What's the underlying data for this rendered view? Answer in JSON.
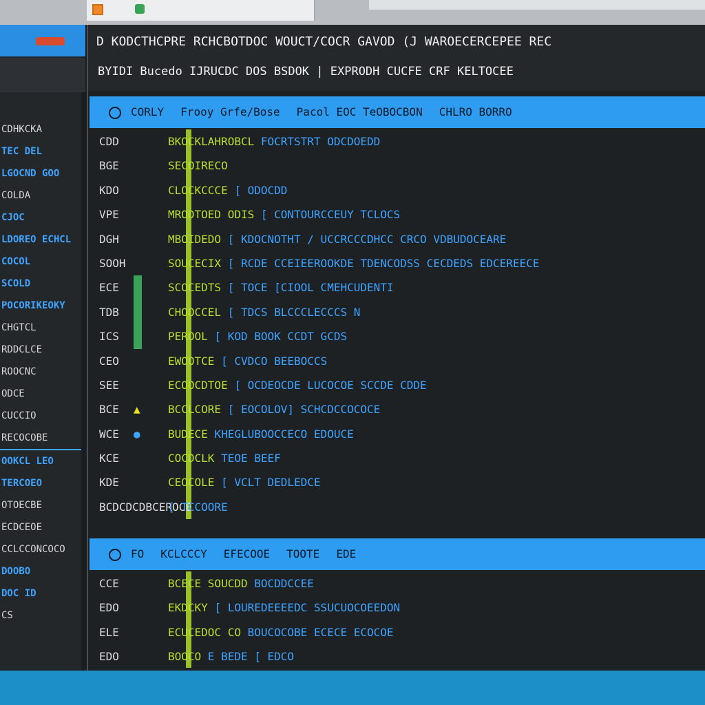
{
  "colors": {
    "accent": "#2e9cf0",
    "keyword": "#b9e02c",
    "link": "#3ea4ff",
    "background": "#1e2124"
  },
  "header": {
    "row1": "D KODCTHCPRE RCHCBOTDOC WOUCT/COCR GAVOD (J WAROECERCEPEE REC",
    "row2": "BYIDI Bucedo IJRUCDC DOS BSDOK | EXPRODH CUCFE CRF KELTOCEE"
  },
  "sidebar": {
    "items": [
      {
        "label": "CDHKCKA"
      },
      {
        "label": "TEC DEL"
      },
      {
        "label": "LGOCND GOO"
      },
      {
        "label": "COLDA"
      },
      {
        "label": "CJOC"
      },
      {
        "label": "LDOREO ECHCL"
      },
      {
        "label": "COCOL"
      },
      {
        "label": "SCOLD"
      },
      {
        "label": "POCORIKEOKY"
      },
      {
        "label": "CHGTCL"
      },
      {
        "label": "RDDCLCE"
      },
      {
        "label": "ROOCNC"
      },
      {
        "label": "ODCE"
      },
      {
        "label": "CUCCIO"
      },
      {
        "label": "RECOCOBE"
      },
      {
        "label": "OOKCL LEO"
      },
      {
        "label": "TERCOEO"
      },
      {
        "label": "OTOECBE"
      },
      {
        "label": "ECDCEOE"
      },
      {
        "label": "CCLCCONCOCO"
      },
      {
        "label": "DOOBO"
      },
      {
        "label": "DOC ID"
      },
      {
        "label": "CS"
      }
    ]
  },
  "pane1": {
    "tabs": [
      "CORLY",
      "Frooy Grfe/Bose",
      "Pacol EOC TeOBOCBON",
      "CHLRO BORRO"
    ],
    "lines": [
      {
        "n": "CDD",
        "kw": "BKOCKLAHROBCL",
        "rest": " FOCRTSTRT ODCDOEDD"
      },
      {
        "n": "BGE",
        "kw": "SECOIRECO",
        "rest": ""
      },
      {
        "n": "KDO",
        "kw": "CLOCKCCCE",
        "rest": " [ ODOCDD"
      },
      {
        "n": "VPE",
        "kw": "MRODTOED ODIS",
        "rest": " [ CONTOURCCEUY TCLOCS"
      },
      {
        "n": "DGH",
        "kw": "MBOIDEDO",
        "rest": " [ KDOCNOTHT / UCCRCCCDHCC CRCO VDBUDOCEARE"
      },
      {
        "n": "SOOH",
        "kw": "SOUCECIX",
        "rest": " [ RCDE CCEIEEROOKDE TDENCODSS CECDEDS EDCEREECE"
      },
      {
        "n": "ECE",
        "kw": "SCOCEDTS",
        "rest": " [ TOCE [CIOOL CMEHCUDENTI"
      },
      {
        "n": "TDB",
        "kw": "CHOOCCEL",
        "rest": " [ TDCS BLCCCLECCCS N"
      },
      {
        "n": "ICS",
        "kw": "PEROOL",
        "rest": " [ KOD BOOK CCDT GCDS"
      },
      {
        "n": "CEO",
        "kw": "EWOOTCE",
        "rest": " [ CVDCO BEEBOCCS"
      },
      {
        "n": "SEE",
        "kw": "ECOOCDTOE",
        "rest": " [ OCDEOCDE LUCOCOE SCCDE CDDE"
      },
      {
        "n": "BCE",
        "kw": "BCCLCORE",
        "rest": " [ EOCOLOV] SCHCDCCOCOCE"
      },
      {
        "n": "WCE",
        "kw": "BUDECE",
        "rest": " KHEGLUBOOCCECO EDOUCE"
      },
      {
        "n": "KCE",
        "kw": "COCDCLK",
        "rest": " TEOE BEEF"
      },
      {
        "n": "KDE",
        "kw": "CEOCOLE",
        "rest": " [ VCLT DEDLEDCE"
      },
      {
        "n": "BCDCDCDBCEROCE",
        "kw": "",
        "rest": " [ TCCOORE"
      }
    ]
  },
  "pane2": {
    "tabs": [
      "FO",
      "KCLCCCY",
      "EFECOOE",
      "TOOTE",
      "EDE"
    ],
    "lines": [
      {
        "n": "CCE",
        "kw": "BCECE SOUCDD",
        "rest": " BOCDDCCEE"
      },
      {
        "n": "EDO",
        "kw": "EKDCKY",
        "rest": " [ LOUREDEEEEDC SSUCUOCOEEDON"
      },
      {
        "n": "ELE",
        "kw": "ECUCEDOC CO",
        "rest": " BOUCOCOBE ECECE ECOCOE"
      },
      {
        "n": "EDO",
        "kw": "BOOCO",
        "rest": " E BEDE [ EDCO"
      }
    ]
  }
}
